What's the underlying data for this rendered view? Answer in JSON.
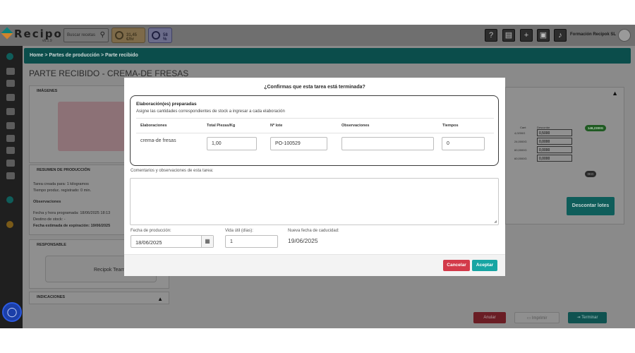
{
  "app": {
    "logo": "Recipok",
    "version": "v6.1.9",
    "search_placeholder": "Buscar recetas",
    "pill_money": "31,45 €/hr",
    "pill_percent": "58 %",
    "company": "Formación Recipok SL"
  },
  "breadcrumb": {
    "home": "Home",
    "sep1": ">",
    "section": "Partes de producción",
    "sep2": ">",
    "current": "Parte recibido"
  },
  "page": {
    "title": "PARTE RECIBIDO - CREMA-DE FRESAS",
    "images_header": "IMÁGENES",
    "summary_header": "RESUMEN DE PRODUCCIÓN",
    "summary_lines": [
      "Tarea creada para: 1 kilogramos",
      "Tiempo produc. registrado: 0 min.",
      "Observaciones",
      "Fecha y hora programada: 18/06/2025 18:13",
      "Destino de stock: -",
      "Fecha estimada de expiración: 19/06/2025"
    ],
    "responsible_header": "RESPONSABLE",
    "responsible_name": "Recipok Team",
    "indications_header": "INDICACIONES",
    "bg_col_cant": "Cant",
    "bg_col_descontar": "Descontar",
    "bg_rows": [
      {
        "qty": "4,0200G",
        "val": "0,5000"
      },
      {
        "qty": "24,0000G",
        "val": "0,0000"
      },
      {
        "qty": "60,0000G",
        "val": "0,0000"
      },
      {
        "qty": "60,0000G",
        "val": "0,0000"
      }
    ],
    "badge_total": "148,2300G",
    "badge_small": "0KG",
    "descontar_button": "Descontar lotes",
    "anular_button": "Anular",
    "imprimir_button": "Imprimir",
    "terminar_button": "Terminar"
  },
  "modal": {
    "title": "¿Confirmas que esta tarea está terminada?",
    "section_title": "Elaboración(es) preparadas",
    "section_subtitle": "Asigne las cantidades correspondientes de stock a ingresar a cada elaboración",
    "columns": [
      "Elaboraciones",
      "Total Piezas/Kg",
      "Nº lote",
      "Observaciones",
      "Tiempos"
    ],
    "row": {
      "elaboracion": "crema-de fresas",
      "total": "1,00",
      "lote": "PO-100529",
      "observaciones": "",
      "tiempos": "0"
    },
    "comments_label": "Comentarios y observaciones de esta tarea:",
    "comments_value": "",
    "production_date_label": "Fecha de producción:",
    "production_date": "18/06/2025",
    "shelf_life_label": "Vida útil (días):",
    "shelf_life": "1",
    "new_expiry_label": "Nueva fecha de caducidad:",
    "new_expiry": "19/06/2025",
    "cancel_label": "Cancelar",
    "accept_label": "Aceptar"
  },
  "colors": {
    "teal": "#17a5a3",
    "red": "#d33a4a",
    "dark_teal": "#0b4d4b"
  }
}
